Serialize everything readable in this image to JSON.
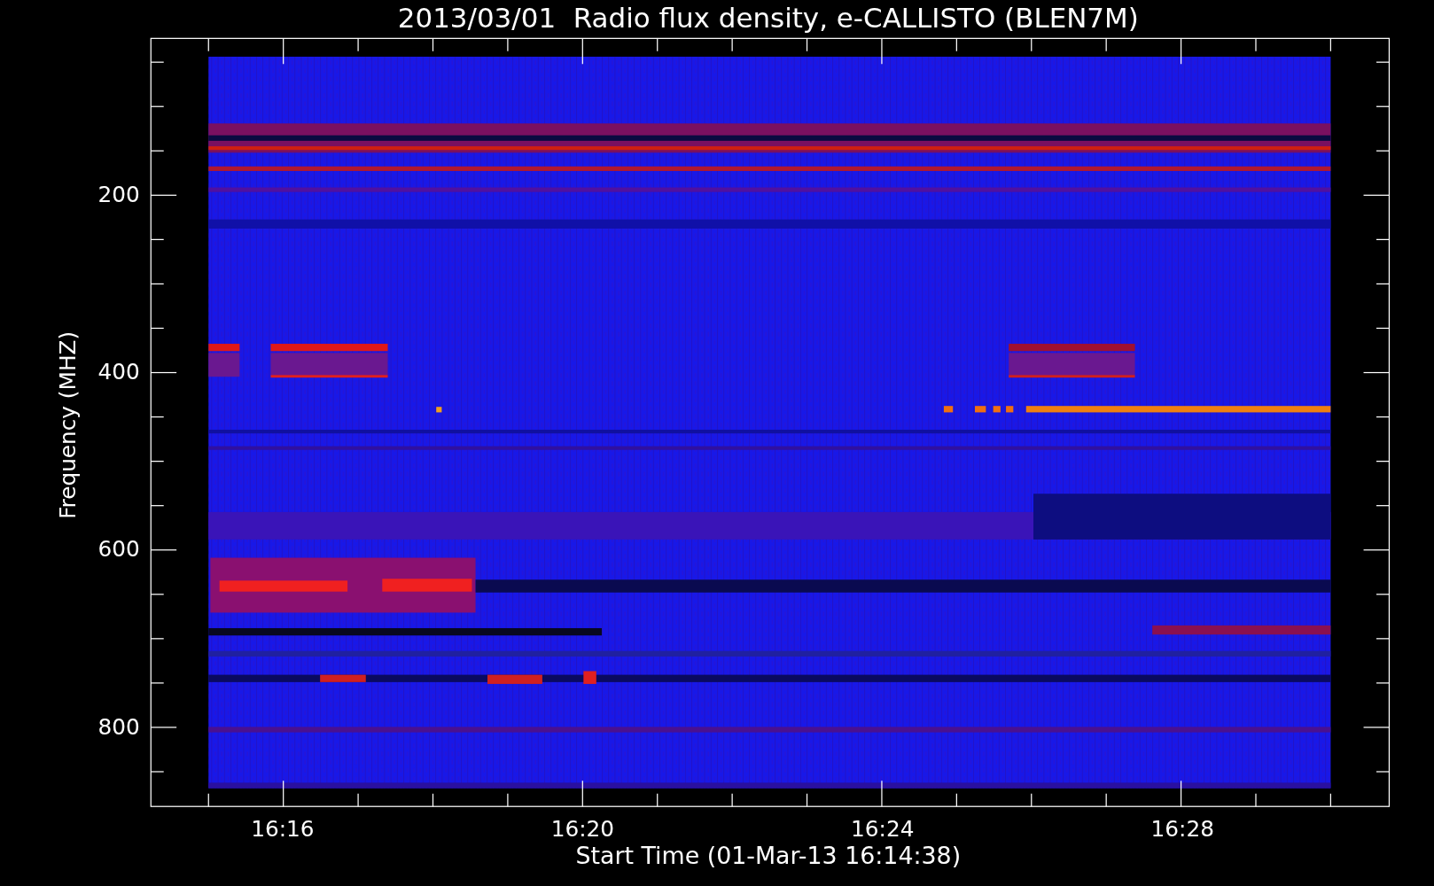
{
  "plot": {
    "title": "2013/03/01  Radio flux density, e-CALLISTO (BLEN7M)",
    "ylabel": "Frequency (MHZ)",
    "xlabel": "Start Time (01-Mar-13 16:14:38)",
    "y_tick_labels": [
      "200",
      "400",
      "600",
      "800"
    ],
    "x_tick_labels": [
      "16:16",
      "16:20",
      "16:24",
      "16:28"
    ]
  }
}
